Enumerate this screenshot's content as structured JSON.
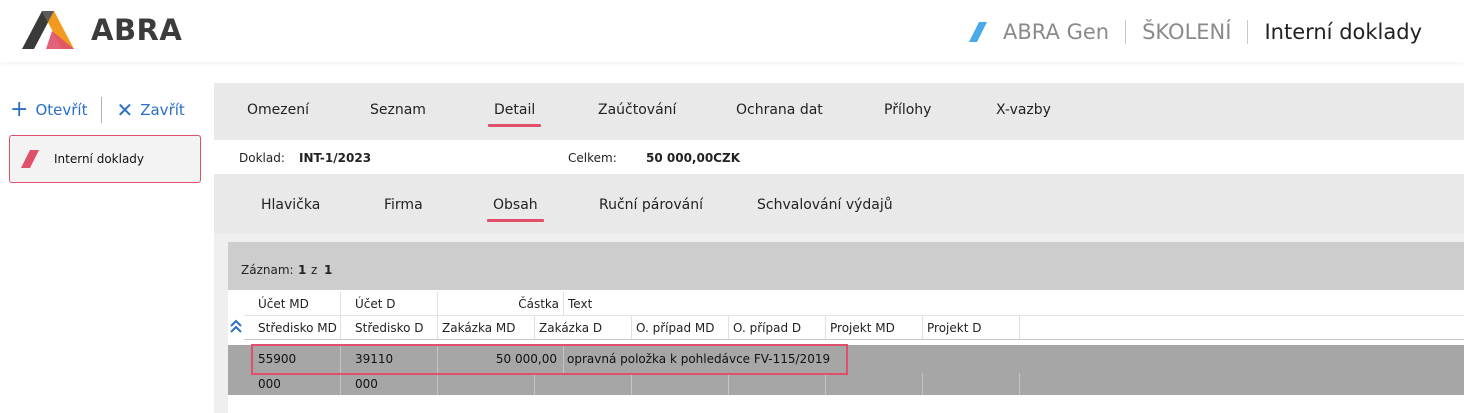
{
  "header": {
    "logo_text": "ABRA",
    "breadcrumbs": [
      "ABRA Gen",
      "ŠKOLENÍ",
      "Interní doklady"
    ]
  },
  "left": {
    "open_label": "Otevřít",
    "close_label": "Zavřít",
    "doc_card_label": "Interní doklady"
  },
  "tabs_main": [
    {
      "label": "Omezení",
      "active": false
    },
    {
      "label": "Seznam",
      "active": false
    },
    {
      "label": "Detail",
      "active": true
    },
    {
      "label": "Zaúčtování",
      "active": false
    },
    {
      "label": "Ochrana dat",
      "active": false
    },
    {
      "label": "Přílohy",
      "active": false
    },
    {
      "label": "X-vazby",
      "active": false
    }
  ],
  "docinfo": {
    "doklad_label": "Doklad:",
    "doklad_value": "INT-1/2023",
    "celkem_label": "Celkem:",
    "celkem_value": "50 000,00CZK"
  },
  "tabs_sub": [
    {
      "label": "Hlavička",
      "active": false
    },
    {
      "label": "Firma",
      "active": false
    },
    {
      "label": "Obsah",
      "active": true
    },
    {
      "label": "Ruční párování",
      "active": false
    },
    {
      "label": "Schvalování výdajů",
      "active": false
    }
  ],
  "record": {
    "label": "Záznam:",
    "current": "1",
    "of": "z",
    "total": "1"
  },
  "grid": {
    "header1": [
      "Účet MD",
      "Účet D",
      "Částka",
      "Text"
    ],
    "header2": [
      "Středisko MD",
      "Středisko D",
      "Zakázka MD",
      "Zakázka D",
      "O. případ MD",
      "O. případ D",
      "Projekt MD",
      "Projekt D"
    ],
    "row1": {
      "ucet_md": "55900",
      "ucet_d": "39110",
      "castka": "50 000,00",
      "text": "opravná položka k pohledávce FV-115/2019"
    },
    "row2": {
      "stredisko_md": "000",
      "stredisko_d": "000"
    }
  },
  "colors": {
    "accent": "#e0506a",
    "link": "#2a6fc4"
  }
}
